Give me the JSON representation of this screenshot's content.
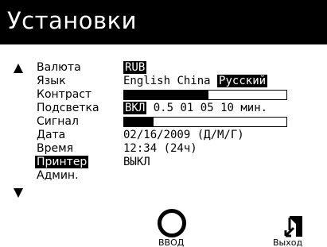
{
  "title": "Установки",
  "settings": {
    "currency": {
      "label": "Валюта",
      "value": "RUB"
    },
    "language": {
      "label": "Язык",
      "options": [
        "English",
        "China",
        "Русский"
      ],
      "selected": "Русский"
    },
    "contrast": {
      "label": "Контраст",
      "level": 0.52
    },
    "backlight": {
      "label": "Подсветка",
      "options": [
        "ВКЛ",
        "0.5",
        "01",
        "05",
        "10"
      ],
      "selected": "ВКЛ",
      "unit": "мин."
    },
    "signal": {
      "label": "Сигнал",
      "level": 0.18
    },
    "date": {
      "label": "Дата",
      "value": "02/16/2009 (Д/М/Г)"
    },
    "time": {
      "label": "Время",
      "value": "12:34 (24ч)"
    },
    "printer": {
      "label": "Принтер",
      "value": "ВЫКЛ"
    },
    "admin": {
      "label": "Админ."
    }
  },
  "buttons": {
    "ok": "ВВОД",
    "exit": "Выход"
  },
  "icons": {
    "scroll_up": "triangle-up-icon",
    "scroll_down": "triangle-down-icon",
    "ok": "circle-icon",
    "exit": "door-exit-icon"
  },
  "colors": {
    "foreground": "#000000",
    "background": "#ffffff"
  }
}
